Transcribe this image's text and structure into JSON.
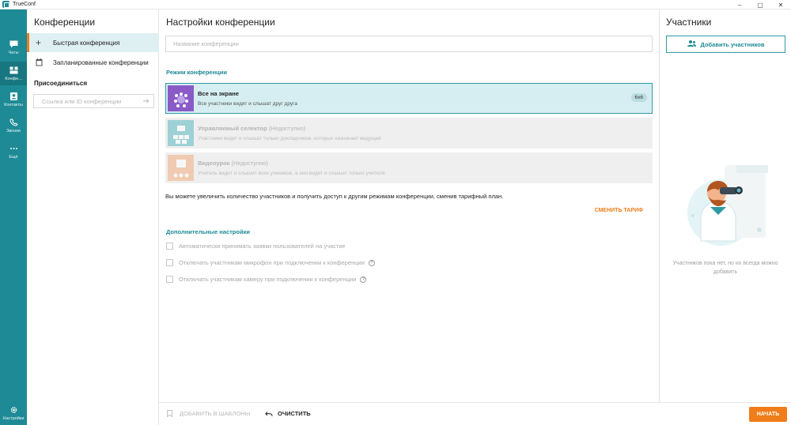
{
  "window": {
    "title": "TrueConf",
    "controls": [
      "–",
      "▢",
      "✕"
    ]
  },
  "rail": {
    "items": [
      {
        "label": "Чаты",
        "icon": "chat-icon"
      },
      {
        "label": "Конфе...",
        "icon": "conference-icon",
        "active": true
      },
      {
        "label": "Контакты",
        "icon": "contacts-icon"
      },
      {
        "label": "Звонки",
        "icon": "phone-icon"
      },
      {
        "label": "Ещё",
        "icon": "more-icon"
      }
    ],
    "settings_label": "Настройки"
  },
  "conferences": {
    "title": "Конференции",
    "items": [
      {
        "label": "Быстрая конференция",
        "icon": "plus-icon",
        "active": true
      },
      {
        "label": "Запланированные конференции",
        "icon": "calendar-icon"
      }
    ],
    "join_title": "Присоединиться",
    "join_placeholder": "Ссылка или ID конференции"
  },
  "settings": {
    "title": "Настройки конференции",
    "name_placeholder": "Название конференции",
    "mode_section": "Режим конференции",
    "modes": [
      {
        "name": "Все на экране",
        "unavailable": "",
        "desc": "Все участники видят и слышат друг друга",
        "badge": "6x6",
        "selected": true
      },
      {
        "name": "Управляемый селектор",
        "unavailable": "(Недоступно)",
        "desc": "Участники видят и слышат только докладчиков, которых назначает ведущий",
        "badge": "",
        "selected": false
      },
      {
        "name": "Видеоурок",
        "unavailable": "(Недоступно)",
        "desc": "Учитель видит и слышит всех учеников, а они видят и слышат только учителя",
        "badge": "",
        "selected": false
      }
    ],
    "info_text": "Вы можете увеличить количество участников и получить доступ к другим режимам конференции, сменив тарифный план.",
    "tariff_link": "СМЕНИТЬ ТАРИФ",
    "extra_section": "Дополнительные настройки",
    "options": [
      {
        "label": "Автоматически принимать заявки пользователей на участие",
        "help": false
      },
      {
        "label": "Отключать участникам микрофон при подключении к конференции",
        "help": true
      },
      {
        "label": "Отключать участникам камеру при подключении к конференции",
        "help": true
      }
    ],
    "help_glyph": "?"
  },
  "participants": {
    "title": "Участники",
    "add_button": "Добавить участников",
    "empty_text": "Участников пока нет, но их всегда можно добавить"
  },
  "bottom": {
    "templates_label": "ДОБАВИТЬ В ШАБЛОНЫ",
    "clear_label": "ОЧИСТИТЬ",
    "start_label": "НАЧАТЬ"
  },
  "colors": {
    "accent": "#1e8a95",
    "orange": "#f07d1a",
    "selected_card": "#d6eef1"
  }
}
